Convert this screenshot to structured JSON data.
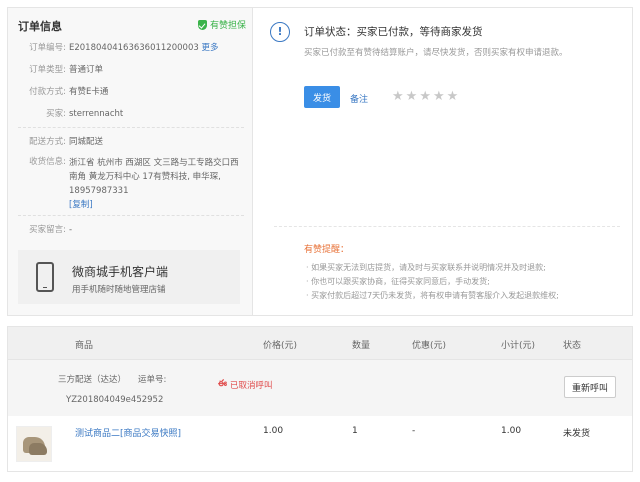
{
  "order_info": {
    "title": "订单信息",
    "guarantee": "有赞担保",
    "fields": [
      {
        "key": "订单编号:",
        "value": "E20180404163636011200003",
        "link": "更多"
      },
      {
        "key": "订单类型:",
        "value": "普通订单"
      },
      {
        "key": "付款方式:",
        "value": "有赞E卡通"
      },
      {
        "key": "买家:",
        "value": "sterrennacht"
      }
    ],
    "delivery_key": "配送方式:",
    "delivery_value": "同城配送",
    "address_key": "收货信息:",
    "address_value": "浙江省 杭州市 西湖区 文三路与工专路交口西南角 黄龙万科中心 17有赞科技, 申华琛, 18957987331",
    "copy_link": "[复制]",
    "message_key": "买家留言:",
    "message_value": "-"
  },
  "app_promo": {
    "icon": "phone-icon",
    "title": "微商城手机客户端",
    "subtitle": "用手机随时随地管理店铺"
  },
  "order_status": {
    "icon": "info-icon",
    "title": "订单状态：买家已付款，等待商家发货",
    "description": "买家已付款至有赞待结算账户，请尽快发货，否则买家有权申请退款。",
    "ship_button": "发货",
    "remark_link": "备注",
    "stars": [
      "★",
      "★",
      "★",
      "★",
      "★"
    ],
    "rating": 0
  },
  "hints": {
    "title": "有赞提醒：",
    "lines": [
      "· 如果买家无法到店提货，请及时与买家联系并说明情况并及时退款;",
      "· 你也可以跟买家协商，征得买家同意后，手动发货;",
      "· 买家付款后超过7天仍未发货，将有权申请有赞客服介入发起退款维权;"
    ]
  },
  "table": {
    "headers": {
      "product": "商品",
      "price": "价格(元)",
      "qty": "数量",
      "discount": "优惠(元)",
      "subtotal": "小计(元)",
      "status": "状态"
    },
    "package": {
      "method": "三方配送（达达）",
      "waybill_label": "运单号:",
      "waybill_no": "YZ201804049e452952",
      "cancel_note": "已取消呼叫",
      "recall_button": "重新呼叫"
    },
    "items": [
      {
        "name": "测试商品二[商品交易快照]",
        "price": "1.00",
        "qty": "1",
        "discount": "-",
        "subtotal": "1.00",
        "status": "未发货"
      }
    ]
  },
  "colors": {
    "accent": "#3a8ee6",
    "link": "#3a78c3",
    "guarantee": "#3bb34a",
    "warning": "#e8743b",
    "danger": "#e04b4b"
  }
}
